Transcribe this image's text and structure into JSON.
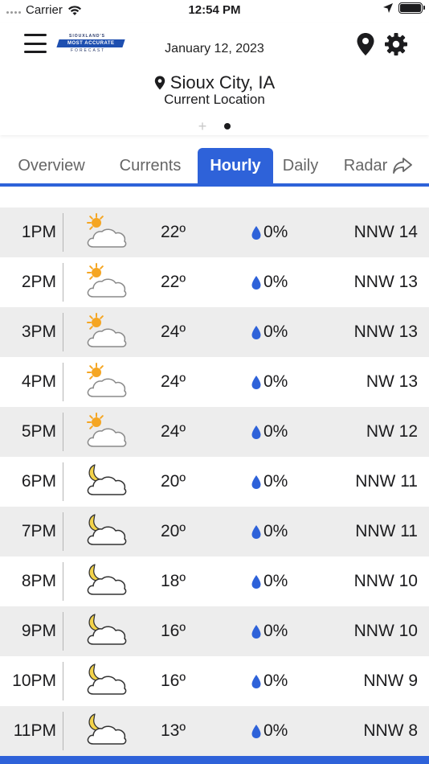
{
  "status_bar": {
    "carrier": "Carrier",
    "time": "12:54 PM"
  },
  "header": {
    "logo_top": "SIOUXLAND'S",
    "logo_main": "MOST ACCURATE",
    "logo_sub": "FORECAST",
    "date": "January 12, 2023",
    "city": "Sioux City, IA",
    "location_label": "Current Location",
    "pager_add": "+"
  },
  "tabs": [
    {
      "label": "Overview",
      "active": false
    },
    {
      "label": "Currents",
      "active": false
    },
    {
      "label": "Hourly",
      "active": true
    },
    {
      "label": "Daily",
      "active": false
    },
    {
      "label": "Radar",
      "active": false
    }
  ],
  "hourly": [
    {
      "time": "1PM",
      "icon": "partly-sunny-icon",
      "temp": "22º",
      "precip": "0%",
      "wind": "NNW 14"
    },
    {
      "time": "2PM",
      "icon": "partly-sunny-icon",
      "temp": "22º",
      "precip": "0%",
      "wind": "NNW 13"
    },
    {
      "time": "3PM",
      "icon": "partly-sunny-icon",
      "temp": "24º",
      "precip": "0%",
      "wind": "NNW 13"
    },
    {
      "time": "4PM",
      "icon": "partly-sunny-icon",
      "temp": "24º",
      "precip": "0%",
      "wind": "NW 13"
    },
    {
      "time": "5PM",
      "icon": "partly-sunny-icon",
      "temp": "24º",
      "precip": "0%",
      "wind": "NW 12"
    },
    {
      "time": "6PM",
      "icon": "partly-cloudy-night-icon",
      "temp": "20º",
      "precip": "0%",
      "wind": "NNW 11"
    },
    {
      "time": "7PM",
      "icon": "partly-cloudy-night-icon",
      "temp": "20º",
      "precip": "0%",
      "wind": "NNW 11"
    },
    {
      "time": "8PM",
      "icon": "partly-cloudy-night-icon",
      "temp": "18º",
      "precip": "0%",
      "wind": "NNW 10"
    },
    {
      "time": "9PM",
      "icon": "partly-cloudy-night-icon",
      "temp": "16º",
      "precip": "0%",
      "wind": "NNW 10"
    },
    {
      "time": "10PM",
      "icon": "partly-cloudy-night-icon",
      "temp": "16º",
      "precip": "0%",
      "wind": "NNW 9"
    },
    {
      "time": "11PM",
      "icon": "partly-cloudy-night-icon",
      "temp": "13º",
      "precip": "0%",
      "wind": "NNW 8"
    }
  ],
  "colors": {
    "accent": "#2e62d9",
    "sun": "#f5a623",
    "moon": "#f3d34a",
    "raindrop": "#2e62d9",
    "row_alt": "#ededed"
  }
}
